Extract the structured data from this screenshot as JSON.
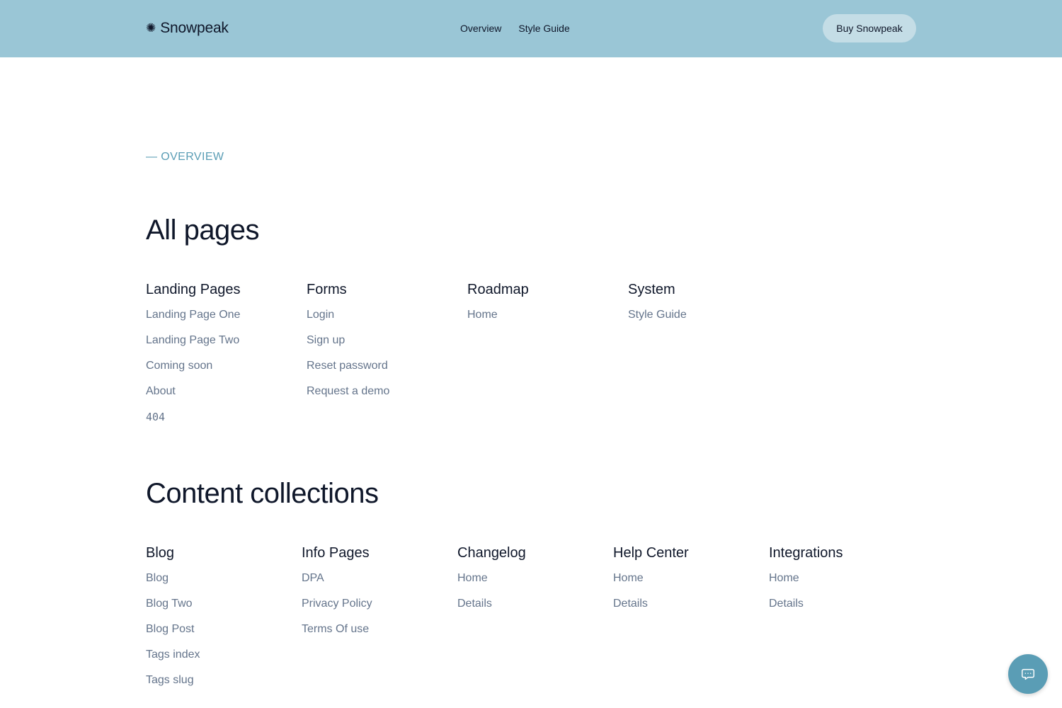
{
  "header": {
    "brand_icon": "✺",
    "brand_name": "Snowpeak",
    "nav": [
      "Overview",
      "Style Guide"
    ],
    "buy_label": "Buy Snowpeak"
  },
  "eyebrow": "— OVERVIEW",
  "all_pages": {
    "title": "All pages",
    "columns": [
      {
        "heading": "Landing Pages",
        "links": [
          "Landing Page One",
          "Landing Page Two",
          "Coming soon",
          "About",
          "404"
        ]
      },
      {
        "heading": "Forms",
        "links": [
          "Login",
          "Sign up",
          "Reset password",
          "Request a demo"
        ]
      },
      {
        "heading": "Roadmap",
        "links": [
          "Home"
        ]
      },
      {
        "heading": "System",
        "links": [
          "Style Guide"
        ]
      }
    ]
  },
  "content_collections": {
    "title": "Content collections",
    "columns": [
      {
        "heading": "Blog",
        "links": [
          "Blog",
          "Blog Two",
          "Blog Post",
          "Tags index",
          "Tags slug"
        ]
      },
      {
        "heading": "Info Pages",
        "links": [
          "DPA",
          "Privacy Policy",
          "Terms Of use"
        ]
      },
      {
        "heading": "Changelog",
        "links": [
          "Home",
          "Details"
        ]
      },
      {
        "heading": "Help Center",
        "links": [
          "Home",
          "Details"
        ]
      },
      {
        "heading": "Integrations",
        "links": [
          "Home",
          "Details"
        ]
      }
    ]
  },
  "chat_icon": "chat-bubble-icon",
  "colors": {
    "header_bg": "#9ac6d6",
    "button_bg": "#c4dde6",
    "accent": "#5a9db5",
    "heading": "#0f172a",
    "link": "#64748b"
  }
}
